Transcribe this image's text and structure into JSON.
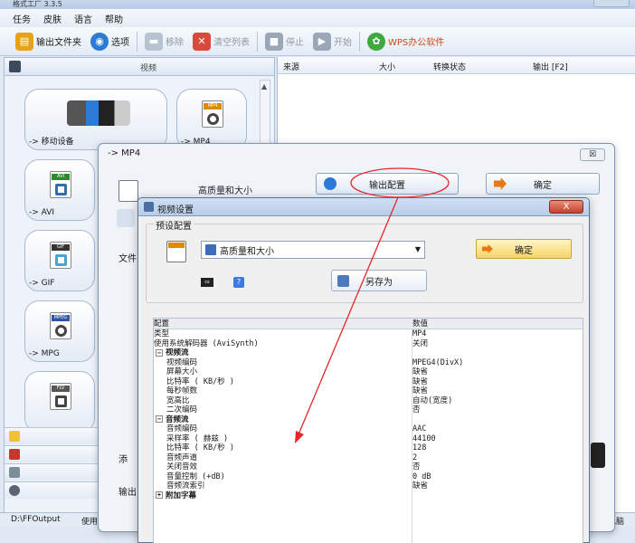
{
  "window": {
    "title": "格式工厂 3.3.5"
  },
  "menu": [
    "任务",
    "皮肤",
    "语言",
    "帮助"
  ],
  "toolbar": {
    "output_folder": "输出文件夹",
    "options": "选项",
    "remove": "移除",
    "clear_list": "清空列表",
    "stop": "停止",
    "start": "开始",
    "wps": "WPS办公软件"
  },
  "left_pane": {
    "header": "视频",
    "tiles": [
      "-> 移动设备",
      "-> MP4",
      "-> AVI",
      "-> GIF",
      "-> MPG"
    ],
    "tile_tags": {
      "mp4": "MP4",
      "avi": "AVI",
      "gif": "GIF",
      "mpeg": "MPEG",
      "flv": "FLV"
    }
  },
  "file_list": {
    "columns": [
      "来源",
      "大小",
      "转换状态",
      "输出 [F2]"
    ]
  },
  "status": {
    "output_path": "D:\\FFOutput",
    "multithread": "使用多线程",
    "right_text": "完成后关闭电脑"
  },
  "mp4_dialog": {
    "title": "-> MP4",
    "close": "☒",
    "quality": "高质量和大小",
    "output_config": "输出配置",
    "ok": "确定",
    "side_file_label": "文件",
    "side_add": "添",
    "side_output": "输出"
  },
  "video_settings": {
    "title": "视频设置",
    "close": "X",
    "preset_legend": "预设配置",
    "preset_value": "高质量和大小",
    "confirm": "确定",
    "save_as": "另存为",
    "grid_header_key": "配置",
    "grid_header_value": "数值",
    "rows": [
      {
        "k": "类型",
        "v": "MP4",
        "indent": false,
        "section": false
      },
      {
        "k": "使用系统解码器 (AviSynth)",
        "v": "关闭",
        "indent": false,
        "section": false
      },
      {
        "k": "视频流",
        "v": "",
        "indent": false,
        "section": true,
        "toggle": "−"
      },
      {
        "k": "视频编码",
        "v": "MPEG4(DivX)",
        "indent": true,
        "section": false
      },
      {
        "k": "屏幕大小",
        "v": "缺省",
        "indent": true,
        "section": false
      },
      {
        "k": "比特率 ( KB/秒 )",
        "v": "缺省",
        "indent": true,
        "section": false
      },
      {
        "k": "每秒帧数",
        "v": "缺省",
        "indent": true,
        "section": false
      },
      {
        "k": "宽高比",
        "v": "自动(宽度)",
        "indent": true,
        "section": false
      },
      {
        "k": "二次编码",
        "v": "否",
        "indent": true,
        "section": false
      },
      {
        "k": "音频流",
        "v": "",
        "indent": false,
        "section": true,
        "toggle": "−"
      },
      {
        "k": "音频编码",
        "v": "AAC",
        "indent": true,
        "section": false
      },
      {
        "k": "采样率 ( 赫兹 )",
        "v": "44100",
        "indent": true,
        "section": false
      },
      {
        "k": "比特率 ( KB/秒 )",
        "v": "128",
        "indent": true,
        "section": false
      },
      {
        "k": "音频声道",
        "v": "2",
        "indent": true,
        "section": false
      },
      {
        "k": "关闭音效",
        "v": "否",
        "indent": true,
        "section": false
      },
      {
        "k": "音量控制 (+dB)",
        "v": "0 dB",
        "indent": true,
        "section": false
      },
      {
        "k": "音频流索引",
        "v": "缺省",
        "indent": true,
        "section": false
      },
      {
        "k": "附加字幕",
        "v": "",
        "indent": false,
        "section": true,
        "toggle": "+"
      }
    ]
  },
  "colors": {
    "annotation_red": "#e8252a",
    "mp4_tag": "#e08a00",
    "avi_tag": "#2f8a2f",
    "gif_tag": "#333333",
    "mpeg_tag": "#2d56a8",
    "flv_tag": "#555555"
  }
}
